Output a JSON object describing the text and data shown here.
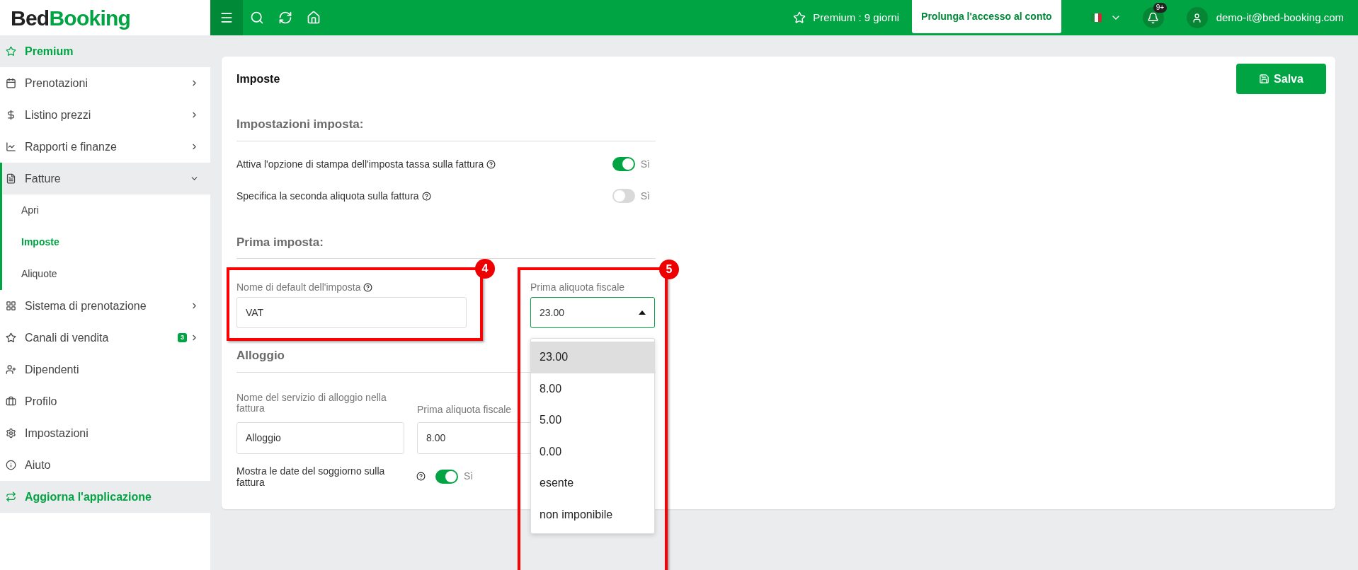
{
  "logo": {
    "first": "Bed",
    "second": "Booking"
  },
  "topbar": {
    "premium": "Premium : 9 giorni",
    "extend_button": "Prolunga l'accesso al conto",
    "notifications_badge": "9+",
    "user": "demo-it@bed-booking.com"
  },
  "sidebar": {
    "items": [
      {
        "label": "Premium",
        "kind": "highlight"
      },
      {
        "label": "Prenotazioni",
        "kind": "item",
        "expanded": false
      },
      {
        "label": "Listino prezzi",
        "kind": "item",
        "expanded": false
      },
      {
        "label": "Rapporti e finanze",
        "kind": "item",
        "expanded": false
      },
      {
        "label": "Fatture",
        "kind": "item",
        "expanded": true,
        "children": [
          {
            "label": "Apri",
            "selected": false
          },
          {
            "label": "Imposte",
            "selected": true
          },
          {
            "label": "Aliquote",
            "selected": false
          }
        ]
      },
      {
        "label": "Sistema di prenotazione",
        "kind": "item",
        "expanded": false
      },
      {
        "label": "Canali di vendita",
        "kind": "item",
        "expanded": false,
        "badge": "3"
      },
      {
        "label": "Dipendenti",
        "kind": "item"
      },
      {
        "label": "Profilo",
        "kind": "item"
      },
      {
        "label": "Impostazioni",
        "kind": "item"
      },
      {
        "label": "Aiuto",
        "kind": "item"
      },
      {
        "label": "Aggiorna l'applicazione",
        "kind": "highlight"
      }
    ]
  },
  "card": {
    "title": "Imposte",
    "save_button": "Salva",
    "settings_heading": "Impostazioni imposta:",
    "toggles": [
      {
        "label": "Attiva l'opzione di stampa dell'imposta tassa sulla fattura",
        "on": true,
        "value_label": "Sì"
      },
      {
        "label": "Specifica la seconda aliquota sulla fattura",
        "on": false,
        "value_label": "Sì"
      }
    ],
    "first_tax_heading": "Prima imposta:",
    "tax_name": {
      "label": "Nome di default dell'imposta",
      "value": "VAT"
    },
    "tax_rate": {
      "label": "Prima aliquota fiscale",
      "value": "23.00",
      "open": true,
      "options": [
        {
          "label": "23.00",
          "selected": true
        },
        {
          "label": "8.00",
          "selected": false
        },
        {
          "label": "5.00",
          "selected": false
        },
        {
          "label": "0.00",
          "selected": false
        },
        {
          "label": "esente",
          "selected": false
        },
        {
          "label": "non imponibile",
          "selected": false
        }
      ]
    },
    "lodging_heading": "Alloggio",
    "lodging_name": {
      "label": "Nome del servizio di alloggio nella fattura",
      "value": "Alloggio"
    },
    "lodging_rate": {
      "label": "Prima aliquota fiscale",
      "value": "8.00"
    },
    "stay_dates": {
      "label": "Mostra le date del soggiorno sulla fattura",
      "on": true,
      "value_label": "Sì"
    }
  },
  "annotations": [
    {
      "label": "4"
    },
    {
      "label": "5"
    }
  ]
}
